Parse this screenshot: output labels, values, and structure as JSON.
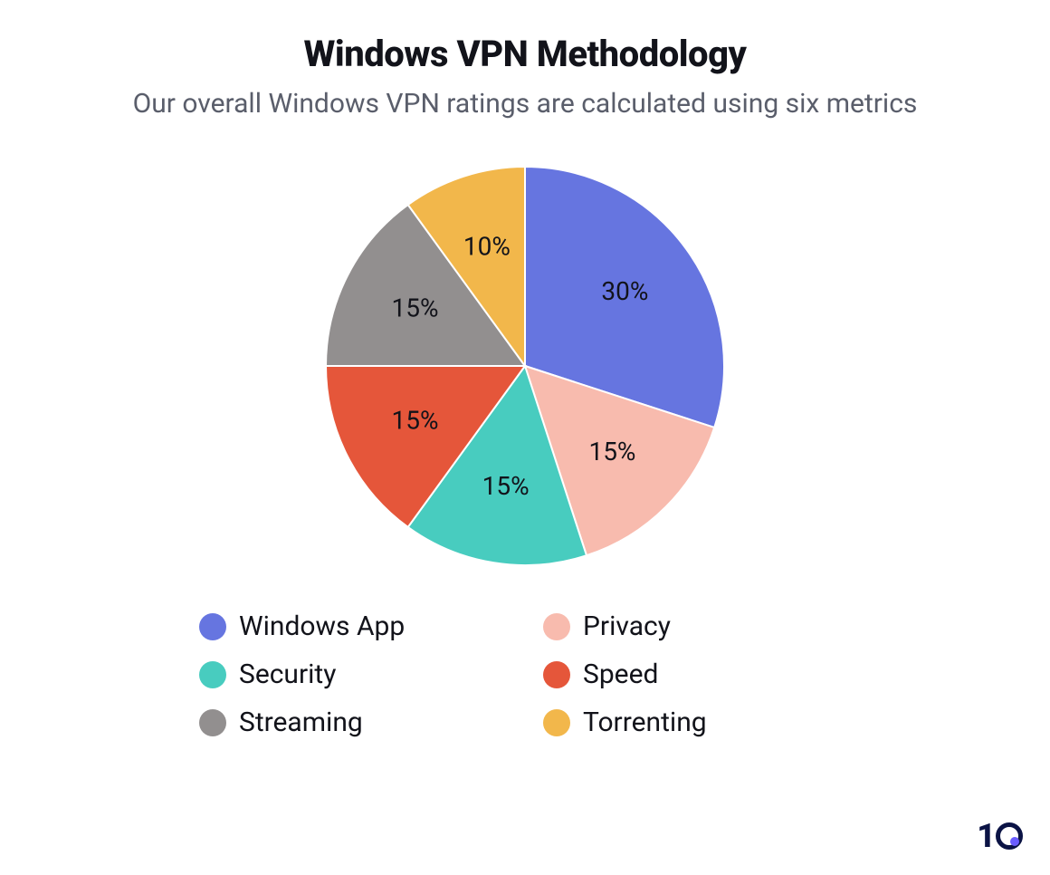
{
  "title": "Windows VPN Methodology",
  "subtitle": "Our overall Windows VPN ratings are calculated using six metrics",
  "brand": "10",
  "chart_data": {
    "type": "pie",
    "title": "Windows VPN Methodology",
    "series": [
      {
        "name": "Windows App",
        "value": 30,
        "label": "30%",
        "color": "#6675e0"
      },
      {
        "name": "Privacy",
        "value": 15,
        "label": "15%",
        "color": "#f8bbae"
      },
      {
        "name": "Security",
        "value": 15,
        "label": "15%",
        "color": "#48ccbf"
      },
      {
        "name": "Speed",
        "value": 15,
        "label": "15%",
        "color": "#e5563a"
      },
      {
        "name": "Streaming",
        "value": 15,
        "label": "15%",
        "color": "#928f8f"
      },
      {
        "name": "Torrenting",
        "value": 10,
        "label": "10%",
        "color": "#f2b74b"
      }
    ],
    "legend_position": "bottom"
  }
}
